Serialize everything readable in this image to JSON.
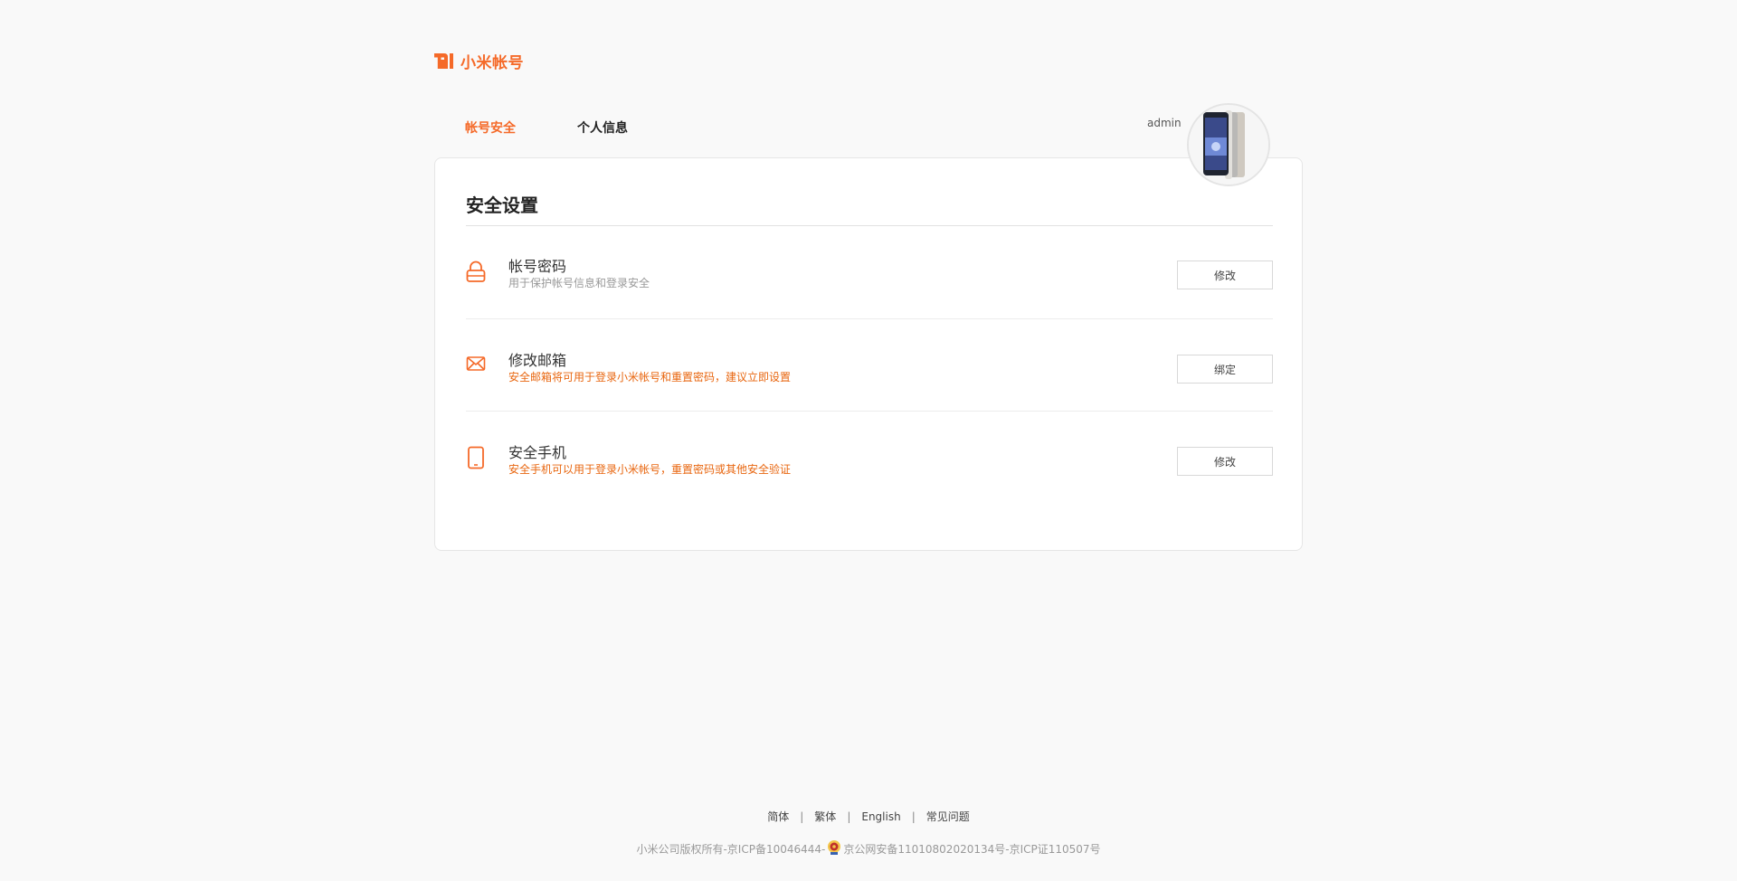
{
  "header": {
    "logo_text": "小米帐号",
    "brand_color": "#f56a29"
  },
  "tabs": [
    {
      "label": "帐号安全",
      "active": true
    },
    {
      "label": "个人信息",
      "active": false
    }
  ],
  "user": {
    "name": "admin",
    "avatar_icon": "phone-avatar-image"
  },
  "card": {
    "title": "安全设置",
    "rows": [
      {
        "icon": "lock-icon",
        "title": "帐号密码",
        "desc": "用于保护帐号信息和登录安全",
        "button": "修改"
      },
      {
        "icon": "mail-icon",
        "title": "修改邮箱",
        "desc": "安全邮箱将可用于登录小米帐号和重置密码，建议立即设置",
        "button": "绑定"
      },
      {
        "icon": "mobile-icon",
        "title": "安全手机",
        "desc": "安全手机可以用于登录小米帐号，重置密码或其他安全验证",
        "button": "修改"
      }
    ]
  },
  "footer": {
    "links": [
      "简体",
      "繁体",
      "English",
      "常见问题"
    ],
    "copyright_prefix": "小米公司版权所有-京ICP备10046444-",
    "copyright_suffix": "京公网安备11010802020134号-京ICP证110507号"
  },
  "colors": {
    "accent": "#f56a29",
    "warning_text": "#e8660f",
    "background": "#f9f9f9"
  }
}
